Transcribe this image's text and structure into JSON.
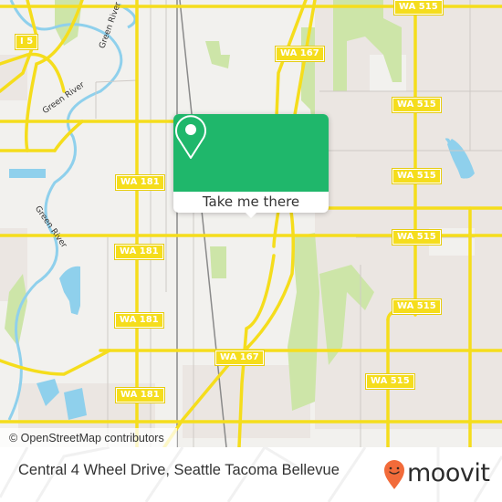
{
  "map": {
    "attribution": "© OpenStreetMap contributors",
    "river_labels": [
      "Green River",
      "Green River",
      "Green River"
    ],
    "shields": [
      {
        "label": "I 5"
      },
      {
        "label": "WA 515"
      },
      {
        "label": "WA 167"
      },
      {
        "label": "WA 515"
      },
      {
        "label": "WA 181"
      },
      {
        "label": "WA 515"
      },
      {
        "label": "WA 181"
      },
      {
        "label": "WA 515"
      },
      {
        "label": "WA 181"
      },
      {
        "label": "WA 515"
      },
      {
        "label": "WA 167"
      },
      {
        "label": "WA 181"
      },
      {
        "label": "WA 515"
      }
    ],
    "colors": {
      "background": "#f2f1ee",
      "road": "#f5dd1c",
      "water": "#8fd0ec",
      "park": "#cde5a8",
      "urban": "#e9e3df"
    }
  },
  "popup": {
    "label": "Take me there",
    "icon": "map-pin-icon",
    "color": "#1fb76b"
  },
  "footer": {
    "title": "Central 4 Wheel Drive, Seattle Tacoma Bellevue",
    "brand": "moovit",
    "brand_color": "#f26b3a"
  }
}
